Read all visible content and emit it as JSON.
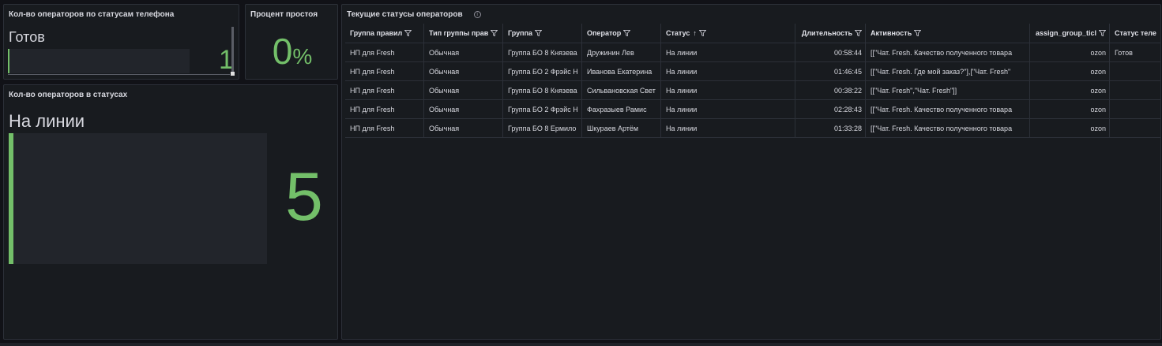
{
  "panel_phone_status": {
    "title": "Кол-во операторов по статусам телефона",
    "status_name": "Готов",
    "value": "1",
    "bar_fraction": 0.01,
    "accent": "#73bf69"
  },
  "panel_idle": {
    "title": "Процент простоя",
    "value": "0",
    "unit": "%"
  },
  "panel_status_count": {
    "title": "Кол-во операторов в статусах",
    "status_name": "На линии",
    "value": "5",
    "bar_fraction": 0.02
  },
  "panel_table": {
    "title": "Текущие статусы операторов",
    "info_icon": "info-icon",
    "columns": [
      {
        "label": "Группа правил",
        "filter": true
      },
      {
        "label": "Тип группы прав",
        "filter": true
      },
      {
        "label": "Группа",
        "filter": true
      },
      {
        "label": "Оператор",
        "filter": true
      },
      {
        "label": "Статус",
        "filter": true,
        "sort": "↑"
      },
      {
        "label": "Длительность",
        "filter": true
      },
      {
        "label": "Активность",
        "filter": true
      },
      {
        "label": "assign_group_ticl",
        "filter": true
      },
      {
        "label": "Статус теле",
        "filter": false
      }
    ],
    "rows": [
      [
        "НП для Fresh",
        "Обычная",
        "Группа БО 8 Князева",
        "Дружинин Лев",
        "На линии",
        "00:58:44",
        "[[\"Чат. Fresh. Качество полученного товара",
        "ozon",
        "Готов"
      ],
      [
        "НП для Fresh",
        "Обычная",
        "Группа БО 2 Фрэйс Н",
        "Иванова Екатерина",
        "На линии",
        "01:46:45",
        "[[\"Чат. Fresh. Где мой заказ?\"],[\"Чат. Fresh\"",
        "ozon",
        ""
      ],
      [
        "НП для Fresh",
        "Обычная",
        "Группа БО 8 Князева",
        "Сильвановская Свет",
        "На линии",
        "00:38:22",
        "[[\"Чат. Fresh\",\"Чат. Fresh\"]]",
        "ozon",
        ""
      ],
      [
        "НП для Fresh",
        "Обычная",
        "Группа БО 2 Фрэйс Н",
        "Фахразыев Рамис",
        "На линии",
        "02:28:43",
        "[[\"Чат. Fresh. Качество полученного товара",
        "ozon",
        ""
      ],
      [
        "НП для Fresh",
        "Обычная",
        "Группа БО 8 Ермило",
        "Шкураев Артём",
        "На линии",
        "01:33:28",
        "[[\"Чат. Fresh. Качество полученного товара",
        "ozon",
        ""
      ]
    ]
  }
}
